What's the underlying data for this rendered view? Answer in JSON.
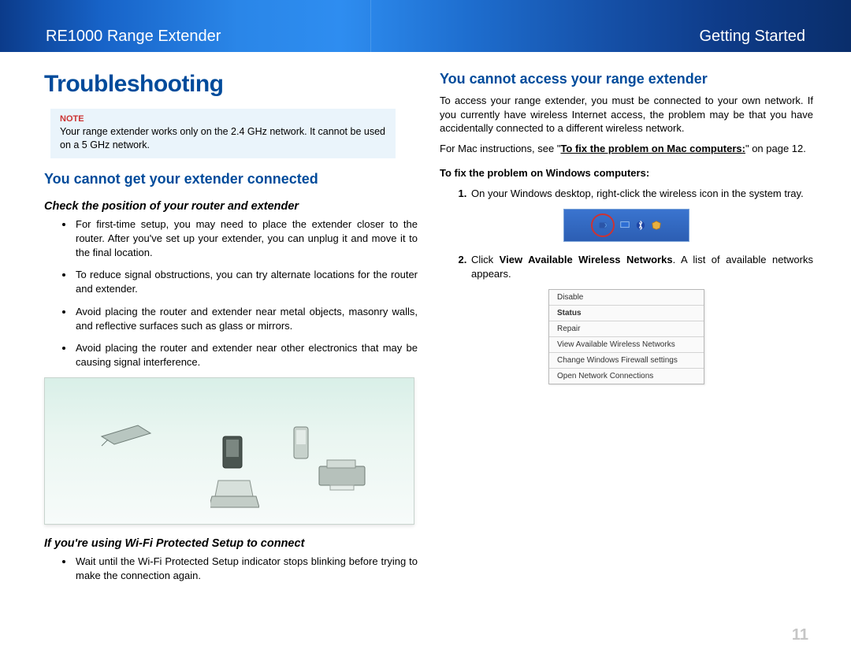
{
  "header": {
    "product": "RE1000 Range Extender",
    "section": "Getting Started"
  },
  "title": "Troubleshooting",
  "note": {
    "label": "Note",
    "text": "Your range extender works only on the 2.4 GHz network. It cannot be used on a 5 GHz network."
  },
  "left": {
    "h2": "You cannot get your extender connected",
    "h3a": "Check the position of your router and extender",
    "bullets": [
      "For first-time setup, you may need to place the extender closer to the router. After you've set up your extender, you can unplug it and move it to the final location.",
      "To reduce signal obstructions, you can try alternate locations for the router and extender.",
      "Avoid placing the router and extender near metal objects, masonry walls, and reflective surfaces such as glass or mirrors.",
      "Avoid placing the router and extender near other electronics that may be causing signal interference."
    ],
    "h3b": "If you're using Wi-Fi Protected Setup to connect",
    "bullets2": [
      "Wait until the Wi-Fi Protected Setup indicator stops blinking before trying to make the connection again."
    ]
  },
  "right": {
    "h2": "You cannot access your range extender",
    "p1": "To access your range extender, you must be connected to your own network. If you currently have wireless Internet access, the problem may be that you have accidentally connected to a different wireless network.",
    "p2_pre": "For Mac instructions, see \"",
    "p2_bold": "To fix the problem on Mac computers:",
    "p2_post": "\" on page 12.",
    "h3": "To fix the problem on Windows computers:",
    "step1": "On your Windows desktop, right-click the wireless icon in the system tray.",
    "step2_pre": "Click ",
    "step2_bold": "View Available Wireless Networks",
    "step2_post": ". A list of available networks appears.",
    "menu": [
      "Disable",
      "Status",
      "Repair",
      "View Available Wireless Networks",
      "Change Windows Firewall settings",
      "Open Network Connections"
    ]
  },
  "page_number": "11"
}
